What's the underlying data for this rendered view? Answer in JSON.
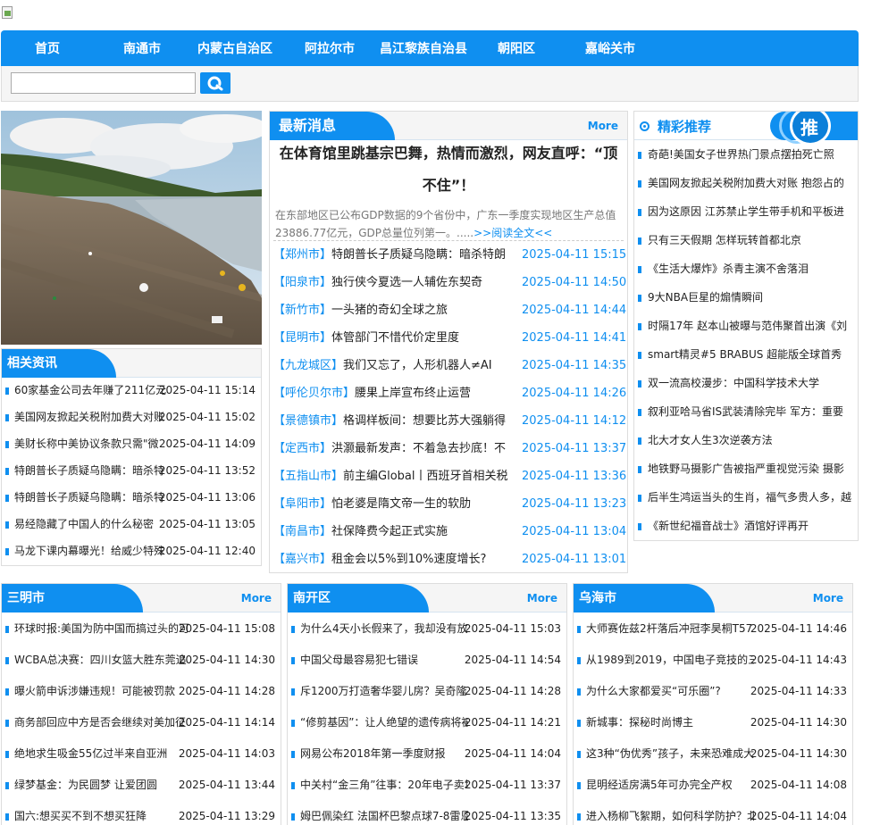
{
  "nav": {
    "items": [
      "首页",
      "南通市",
      "内蒙古自治区",
      "阿拉尔市",
      "昌江黎族自治县",
      "朝阳区",
      "嘉峪关市"
    ]
  },
  "search": {
    "value": "",
    "icon": "search-icon"
  },
  "related": {
    "title": "相关资讯",
    "items": [
      {
        "title": "60家基金公司去年赚了211亿元",
        "date": "2025-04-11 15:14"
      },
      {
        "title": "美国网友掀起关税附加费大对账",
        "date": "2025-04-11 15:02"
      },
      {
        "title": "美财长称中美协议条款只需\"微",
        "date": "2025-04-11 14:09"
      },
      {
        "title": "特朗普长子质疑乌隐瞒：暗杀特",
        "date": "2025-04-11 13:52"
      },
      {
        "title": "特朗普长子质疑乌隐瞒：暗杀特",
        "date": "2025-04-11 13:06"
      },
      {
        "title": "易经隐藏了中国人的什么秘密",
        "date": "2025-04-11 13:05"
      },
      {
        "title": "马龙下课内幕曝光！给威少特殊",
        "date": "2025-04-11 12:40"
      }
    ]
  },
  "latest": {
    "title": "最新消息",
    "more": "More",
    "headline_line1": "在体育馆里跳基宗巴舞，热情而激烈，网友直呼：“顶",
    "headline_line2": "不住”！",
    "summary_line1": "在东部地区已公布GDP数据的9个省份中，广东一季度实现地区生产总值",
    "summary_line2": "23886.77亿元，GDP总量位列第一。.....",
    "read_more": ">>阅读全文<<",
    "items": [
      {
        "city": "【郑州市】",
        "title": "特朗普长子质疑乌隐瞒：暗杀特朗",
        "date": "2025-04-11 15:15"
      },
      {
        "city": "【阳泉市】",
        "title": "独行侠今夏选一人辅佐东契奇",
        "date": "2025-04-11 14:50"
      },
      {
        "city": "【新竹市】",
        "title": "一头猪的奇幻全球之旅",
        "date": "2025-04-11 14:44"
      },
      {
        "city": "【昆明市】",
        "title": "体管部门不惜代价定里度",
        "date": "2025-04-11 14:41"
      },
      {
        "city": "【九龙城区】",
        "title": "我们又忘了，人形机器人≠AI",
        "date": "2025-04-11 14:35"
      },
      {
        "city": "【呼伦贝尔市】",
        "title": "腰果上岸宣布终止运营",
        "date": "2025-04-11 14:26"
      },
      {
        "city": "【景德镇市】",
        "title": "格调样板间：想要比苏大强躺得",
        "date": "2025-04-11 14:12"
      },
      {
        "city": "【定西市】",
        "title": "洪灏最新发声：不着急去抄底！不",
        "date": "2025-04-11 13:37"
      },
      {
        "city": "【五指山市】",
        "title": "前主编Global丨西班牙首相关税",
        "date": "2025-04-11 13:36"
      },
      {
        "city": "【阜阳市】",
        "title": "怕老婆是隋文帝一生的软肋",
        "date": "2025-04-11 13:23"
      },
      {
        "city": "【南昌市】",
        "title": "社保降费今起正式实施",
        "date": "2025-04-11 13:04"
      },
      {
        "city": "【嘉兴市】",
        "title": "租金会以5%到10%速度增长?",
        "date": "2025-04-11 13:01"
      }
    ]
  },
  "recommend": {
    "title": "精彩推荐",
    "badge": "推",
    "items": [
      "奇葩!美国女子世界热门景点摆拍死亡照",
      "美国网友掀起关税附加费大对账 抱怨占的",
      "因为这原因 江苏禁止学生带手机和平板进",
      "只有三天假期 怎样玩转首都北京",
      "《生活大爆炸》杀青主演不舍落泪",
      "9大NBA巨星的煽情瞬间",
      "时隔17年 赵本山被曝与范伟聚首出演《刘",
      "smart精灵#5 BRABUS 超能版全球首秀",
      "双一流高校漫步：中国科学技术大学",
      "叙利亚哈马省IS武装清除完毕 军方：重要",
      "北大才女人生3次逆袭方法",
      "地铁野马摄影广告被指严重视觉污染 摄影",
      "后半生鸿运当头的生肖，福气多贵人多，越",
      "《新世纪福音战士》酒馆好评再开"
    ]
  },
  "columns": [
    {
      "title": "三明市",
      "more": "More",
      "items": [
        {
          "title": "环球时报:美国为防中国而搞过头的可",
          "date": "2025-04-11 15:08"
        },
        {
          "title": "WCBA总决赛：四川女篮大胜东莞追",
          "date": "2025-04-11 14:30"
        },
        {
          "title": "曝火箭申诉涉嫌违规！可能被罚款",
          "date": "2025-04-11 14:28"
        },
        {
          "title": "商务部回应中方是否会继续对美加征",
          "date": "2025-04-11 14:14"
        },
        {
          "title": "绝地求生吸金55亿过半来自亚洲",
          "date": "2025-04-11 14:03"
        },
        {
          "title": "绿梦基金：为民圆梦 让爱团圆",
          "date": "2025-04-11 13:44"
        },
        {
          "title": "国六:想买买不到不想买狂降",
          "date": "2025-04-11 13:29"
        }
      ]
    },
    {
      "title": "南开区",
      "more": "More",
      "items": [
        {
          "title": "为什么4天小长假来了，我却没有放",
          "date": "2025-04-11 15:03"
        },
        {
          "title": "中国父母最容易犯七错误",
          "date": "2025-04-11 14:54"
        },
        {
          "title": "斥1200万打造奢华婴儿房？吴奇隆",
          "date": "2025-04-11 14:28"
        },
        {
          "title": "“修剪基因”：让人绝望的遗传病将被",
          "date": "2025-04-11 14:21"
        },
        {
          "title": "网易公布2018年第一季度财报",
          "date": "2025-04-11 14:04"
        },
        {
          "title": "中关村“金三角”往事：20年电子卖场",
          "date": "2025-04-11 13:37"
        },
        {
          "title": "姆巴佩染红 法国杯巴黎点球7-8雷恩",
          "date": "2025-04-11 13:35"
        }
      ]
    },
    {
      "title": "乌海市",
      "more": "More",
      "items": [
        {
          "title": "大师赛佐兹2杆落后冲冠李昊桐T57",
          "date": "2025-04-11 14:46"
        },
        {
          "title": "从1989到2019，中国电子竞技的三",
          "date": "2025-04-11 14:43"
        },
        {
          "title": "为什么大家都爱买“可乐圈”?",
          "date": "2025-04-11 14:33"
        },
        {
          "title": "新城事：探秘时尚博主",
          "date": "2025-04-11 14:30"
        },
        {
          "title": "这3种“伪优秀”孩子，未来恐难成大",
          "date": "2025-04-11 14:30"
        },
        {
          "title": "昆明经适房满5年可办完全产权",
          "date": "2025-04-11 14:08"
        },
        {
          "title": "进入杨柳飞絮期，如何科学防护？北",
          "date": "2025-04-11 14:04"
        }
      ]
    }
  ],
  "colors": {
    "accent": "#0f8ff0"
  }
}
